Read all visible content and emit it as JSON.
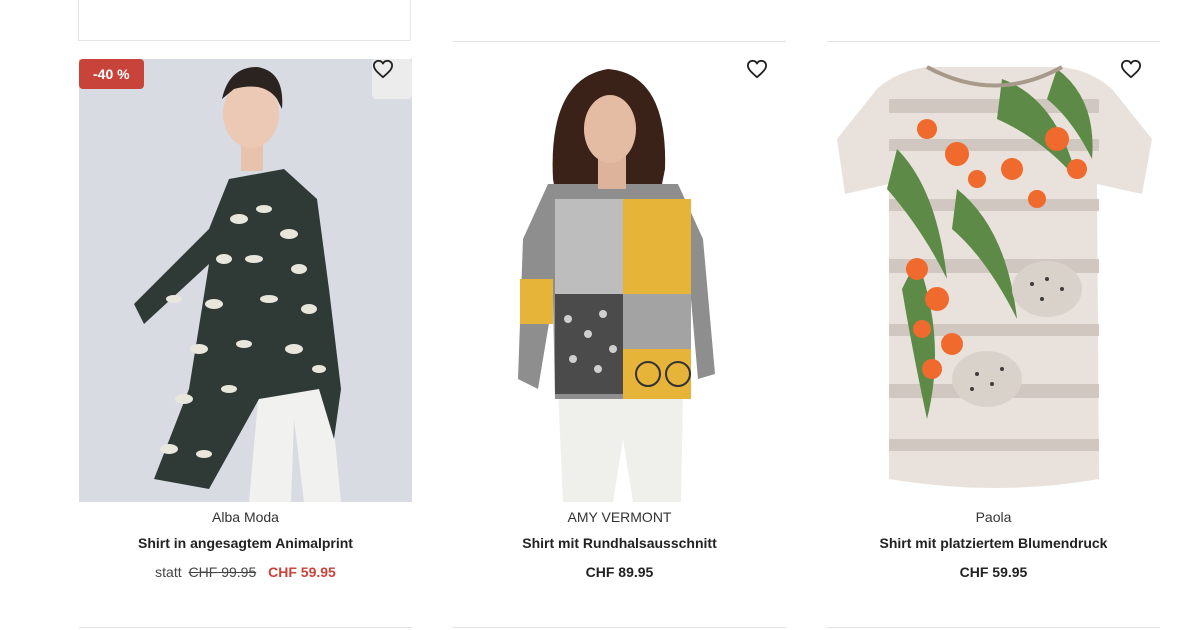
{
  "products": [
    {
      "brand": "Alba Moda",
      "name": "Shirt in angesagtem Animalprint",
      "badge": "-40 %",
      "price_prefix": "statt",
      "price_old": "CHF 99.95",
      "price_new": "CHF 59.95",
      "wishlist_icon": "heart-outline-icon"
    },
    {
      "brand": "AMY VERMONT",
      "name": "Shirt mit Rundhalsausschnitt",
      "price": "CHF 89.95",
      "wishlist_icon": "heart-outline-icon"
    },
    {
      "brand": "Paola",
      "name": "Shirt mit platziertem Blumendruck",
      "price": "CHF 59.95",
      "wishlist_icon": "heart-outline-icon"
    }
  ],
  "colors": {
    "sale_red": "#c8433a",
    "text": "#222222",
    "image_bg_1": "#d9dbe3"
  }
}
